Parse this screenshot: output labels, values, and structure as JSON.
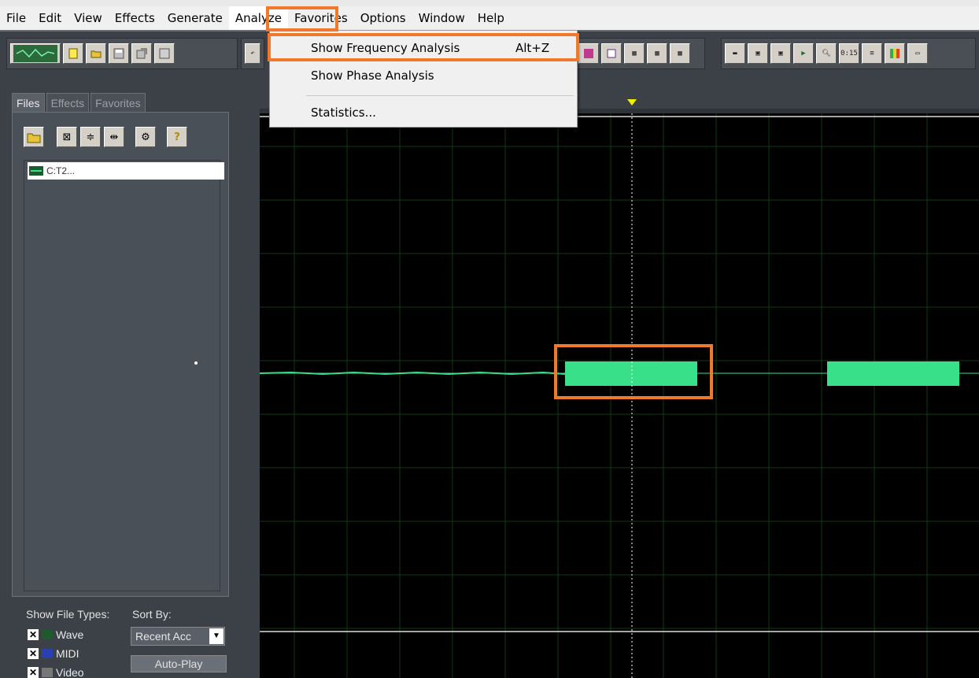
{
  "menubar": {
    "items": [
      "File",
      "Edit",
      "View",
      "Effects",
      "Generate",
      "Analyze",
      "Favorites",
      "Options",
      "Window",
      "Help"
    ],
    "active": "Analyze"
  },
  "analyze_menu": {
    "items": [
      {
        "label": "Show Frequency Analysis",
        "shortcut": "Alt+Z",
        "highlighted": true
      },
      {
        "label": "Show Phase Analysis",
        "shortcut": ""
      },
      {
        "label": "Statistics...",
        "shortcut": ""
      }
    ]
  },
  "left_panel": {
    "tabs": [
      "Files",
      "Effects",
      "Favorites"
    ],
    "active_tab": "Files",
    "file_name": "C:T2...",
    "show_file_types_label": "Show File Types:",
    "sort_by_label": "Sort By:",
    "file_types": [
      {
        "label": "Wave",
        "checked": true
      },
      {
        "label": "MIDI",
        "checked": true
      },
      {
        "label": "Video",
        "checked": true
      }
    ],
    "sort_value": "Recent Acc",
    "autoplay_label": "Auto-Play"
  },
  "toolbar": {
    "time_button_label": "0:15"
  },
  "colors": {
    "highlight": "#ef7a2e",
    "waveform": "#39e08a",
    "grid": "#0f3a12",
    "panel": "#3c4148",
    "menu_bg": "#f0f0f0"
  }
}
